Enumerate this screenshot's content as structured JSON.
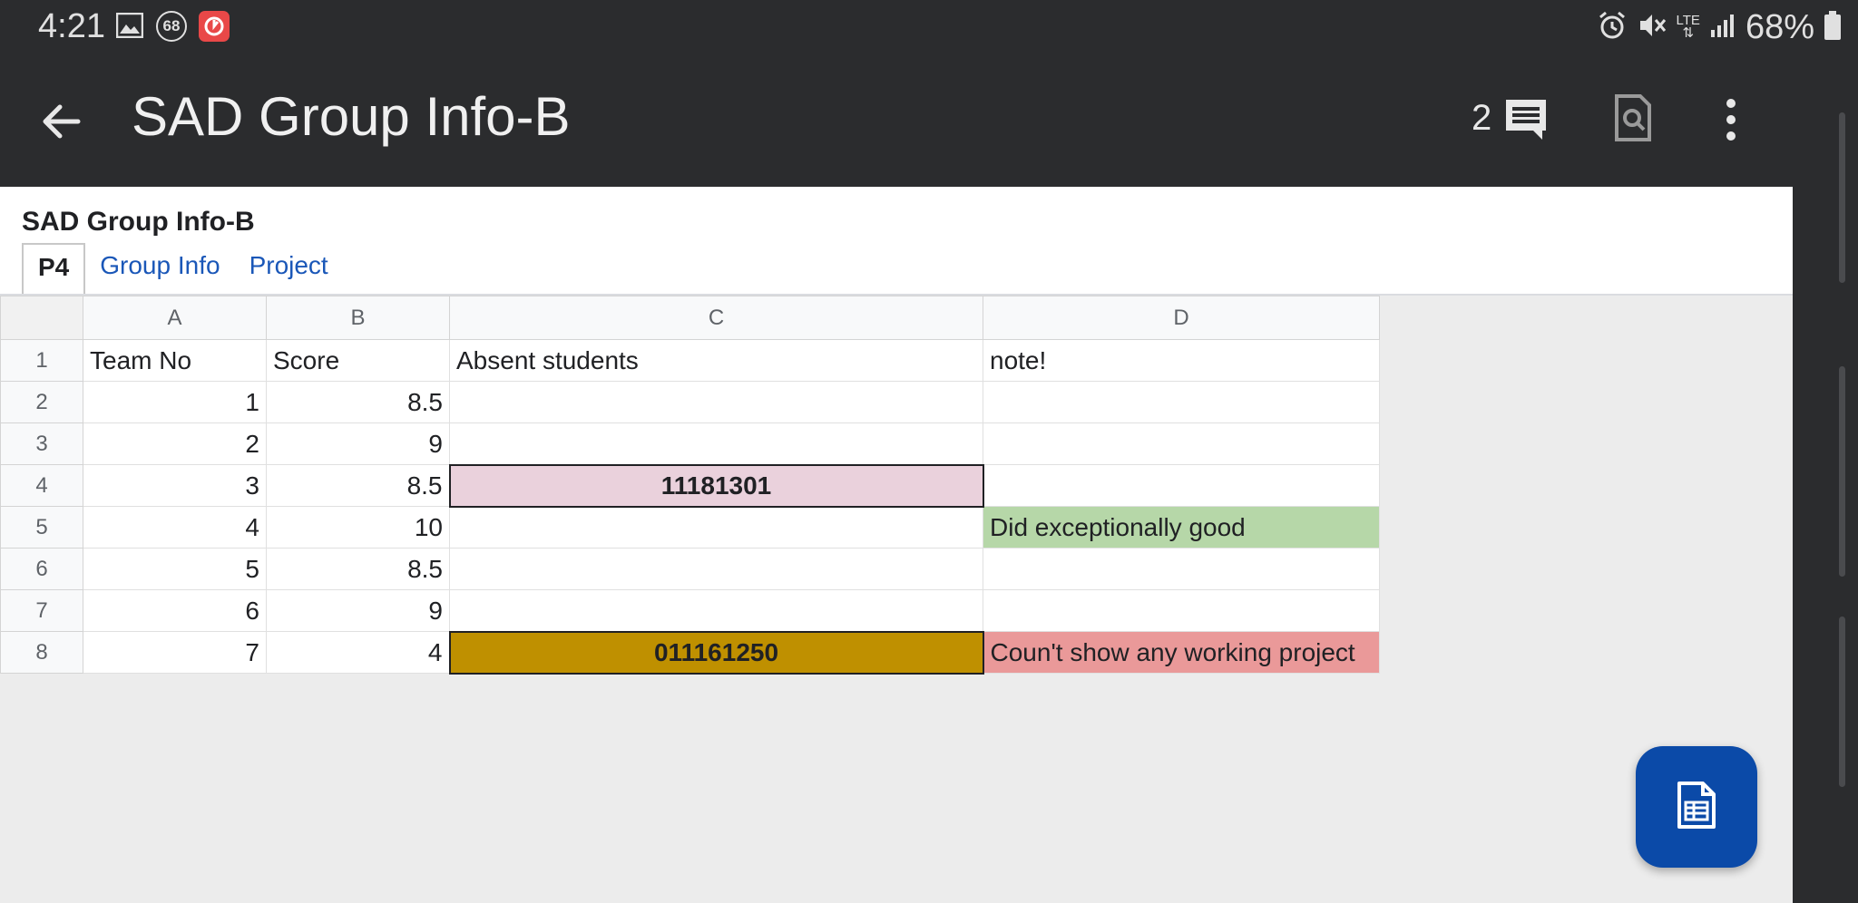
{
  "status_bar": {
    "time": "4:21",
    "notification_badge": "68",
    "network": "LTE",
    "battery": "68%",
    "icons": [
      "image-icon",
      "notification-count-icon",
      "app-alert-icon",
      "alarm-icon",
      "mute-icon",
      "lte-icon",
      "signal-icon",
      "battery-icon"
    ]
  },
  "app_bar": {
    "title": "SAD Group Info-B",
    "comment_count": "2",
    "icons": [
      "back-arrow-icon",
      "comment-icon",
      "find-in-page-icon",
      "more-vert-icon"
    ]
  },
  "sheet": {
    "title": "SAD Group Info-B",
    "tabs": [
      {
        "label": "P4",
        "active": true
      },
      {
        "label": "Group Info",
        "active": false
      },
      {
        "label": "Project",
        "active": false
      }
    ],
    "columns": [
      "A",
      "B",
      "C",
      "D"
    ],
    "row_numbers": [
      "1",
      "2",
      "3",
      "4",
      "5",
      "6",
      "7",
      "8"
    ],
    "rows": [
      [
        "Team No",
        "Score",
        "Absent students",
        "note!"
      ],
      [
        "1",
        "8.5",
        "",
        ""
      ],
      [
        "2",
        "9",
        "",
        ""
      ],
      [
        "3",
        "8.5",
        "11181301",
        ""
      ],
      [
        "4",
        "10",
        "",
        "Did exceptionally good"
      ],
      [
        "5",
        "8.5",
        "",
        ""
      ],
      [
        "6",
        "9",
        "",
        ""
      ],
      [
        "7",
        "4",
        "011161250",
        "Coun't show any working project"
      ]
    ]
  },
  "colors": {
    "pink_fill": "#ead1dc",
    "gold_fill": "#bf9000",
    "green_fill": "#b6d7a8",
    "red_fill": "#ea9999",
    "fab": "#0b4aa8"
  },
  "fab": {
    "icon": "sheets-icon"
  }
}
